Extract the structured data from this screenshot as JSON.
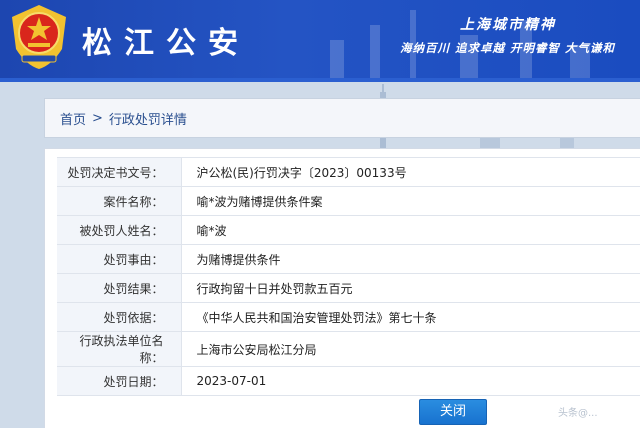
{
  "header": {
    "site_title": "松江公安",
    "city_spirit_label": "上海城市精神",
    "city_spirit_slogan": "海纳百川 追求卓越 开明睿智 大气谦和",
    "colors": {
      "header_bg": "#2454c4",
      "emblem_red": "#d9261c",
      "emblem_gold": "#f2c230"
    }
  },
  "breadcrumb": {
    "home": "首页",
    "separator": ">",
    "current": "行政处罚详情"
  },
  "detail": {
    "rows": [
      {
        "label": "处罚决定书文号：",
        "value": "沪公松(民)行罚决字〔2023〕00133号"
      },
      {
        "label": "案件名称：",
        "value": "喻*波为赌博提供条件案"
      },
      {
        "label": "被处罚人姓名：",
        "value": "喻*波"
      },
      {
        "label": "处罚事由：",
        "value": "为赌博提供条件"
      },
      {
        "label": "处罚结果：",
        "value": "行政拘留十日并处罚款五百元"
      },
      {
        "label": "处罚依据：",
        "value": "《中华人民共和国治安管理处罚法》第七十条"
      },
      {
        "label": "行政执法单位名称：",
        "value": "上海市公安局松江分局"
      },
      {
        "label": "处罚日期：",
        "value": "2023-07-01"
      }
    ]
  },
  "actions": {
    "close_label": "关闭"
  },
  "watermark": "头条@..."
}
